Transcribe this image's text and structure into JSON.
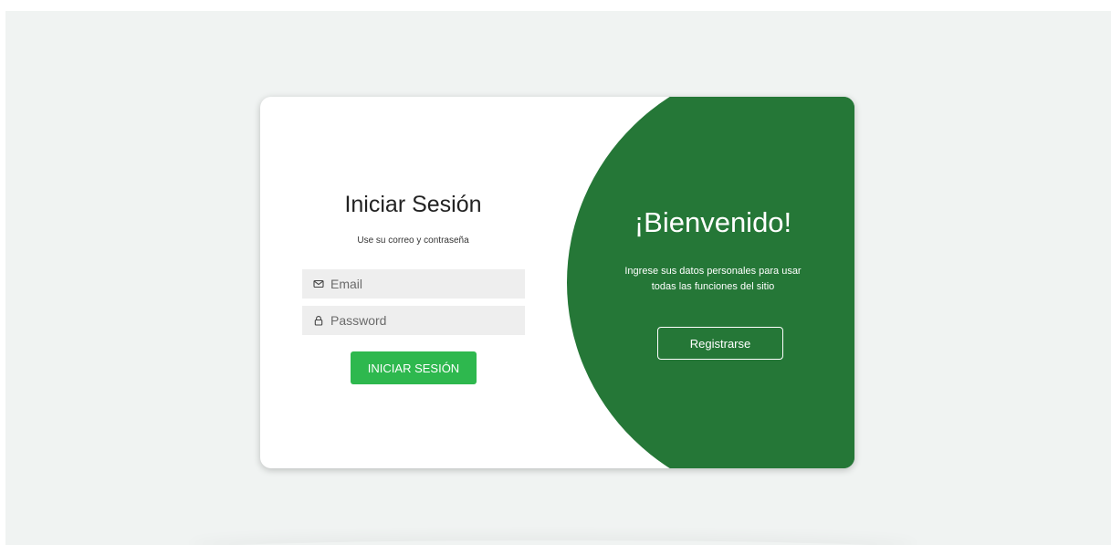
{
  "login": {
    "title": "Iniciar Sesión",
    "subtitle": "Use su correo y contraseña",
    "email_placeholder": "Email",
    "password_placeholder": "Password",
    "email_icon": "envelope-icon",
    "password_icon": "lock-icon",
    "submit_label": "INICIAR SESIÓN"
  },
  "welcome": {
    "title": "¡Bienvenido!",
    "text_line1": "Ingrese sus datos personales para usar",
    "text_line2": "todas las funciones del sitio",
    "register_label": "Registrarse"
  },
  "colors": {
    "page_background": "#f0f3f2",
    "card_background": "#ffffff",
    "green_panel": "#257737",
    "button_green": "#2eb84e",
    "field_background": "#eeeeee"
  }
}
